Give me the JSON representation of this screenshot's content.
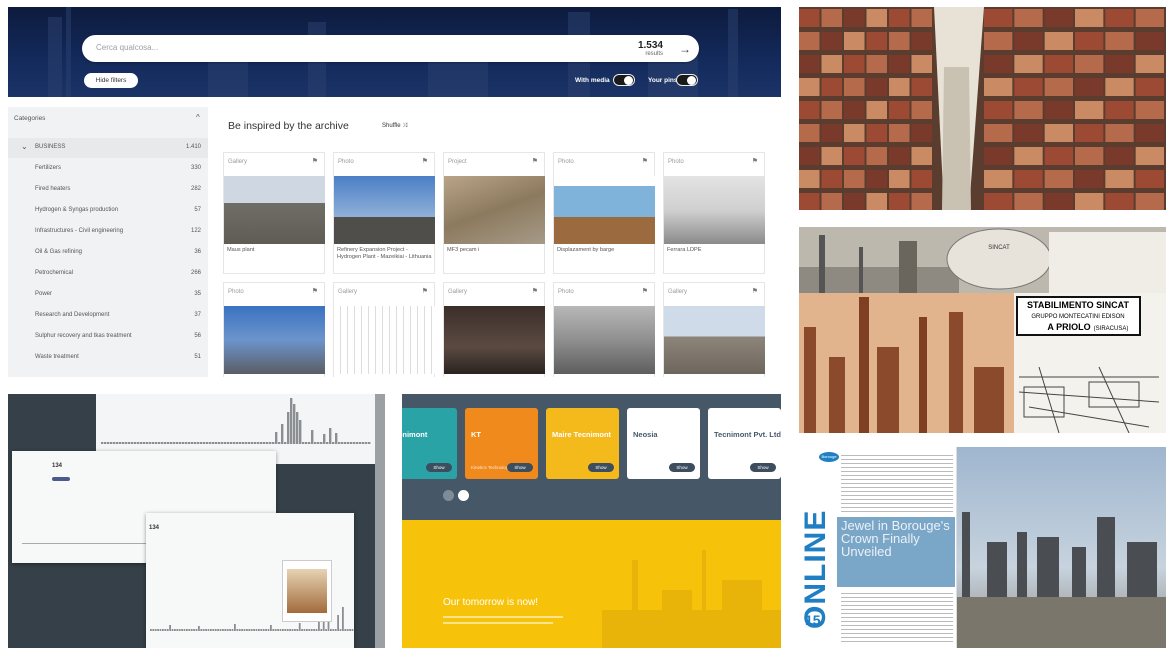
{
  "archive_ui": {
    "search": {
      "placeholder": "Cerca qualcosa...",
      "count": "1.534",
      "count_label": "results",
      "arrow": "→"
    },
    "hide_filters": "Hide filters",
    "toggles": [
      {
        "label": "With media"
      },
      {
        "label": "Your pins"
      }
    ],
    "categories": {
      "title": "Categories",
      "chevron": "^",
      "items": [
        {
          "expand": "⌄",
          "name": "BUSINESS",
          "count": "1.410"
        },
        {
          "expand": "",
          "name": "Fertilizers",
          "count": "330"
        },
        {
          "expand": "",
          "name": "Fired heaters",
          "count": "282"
        },
        {
          "expand": "",
          "name": "Hydrogen & Syngas production",
          "count": "57"
        },
        {
          "expand": "",
          "name": "Infrastructures - Civil engineering",
          "count": "122"
        },
        {
          "expand": "",
          "name": "Oil & Gas refining",
          "count": "36"
        },
        {
          "expand": "",
          "name": "Petrochemical",
          "count": "266"
        },
        {
          "expand": "",
          "name": "Power",
          "count": "35"
        },
        {
          "expand": "",
          "name": "Research and Development",
          "count": "37"
        },
        {
          "expand": "",
          "name": "Sulphur recovery and tkas treatment",
          "count": "56"
        },
        {
          "expand": "",
          "name": "Waste treatment",
          "count": "51"
        }
      ]
    },
    "main_title": "Be inspired by the archive",
    "shuffle": "Shuffle ⤨",
    "cards": [
      {
        "type": "Gallery",
        "caption": "Maus plant"
      },
      {
        "type": "Photo",
        "caption": "Refinery Expansion Project - Hydrogen Plant - Mazeikiai - Lithuania"
      },
      {
        "type": "Project",
        "caption": "MF3 pecam i"
      },
      {
        "type": "Photo",
        "caption": "Displazament by barge"
      },
      {
        "type": "Photo",
        "caption": "Ferrara LDPE"
      },
      {
        "type": "Photo",
        "caption": ""
      },
      {
        "type": "Gallery",
        "caption": ""
      },
      {
        "type": "Gallery",
        "caption": ""
      },
      {
        "type": "Photo",
        "caption": ""
      },
      {
        "type": "Gallery",
        "caption": ""
      }
    ]
  },
  "collage": {
    "sign_line1": "STABILIMENTO SINCAT",
    "sign_line2": "GRUPPO MONTECATINI EDISON",
    "sign_line3": "A PRIOLO",
    "sign_line3b": "(SIRACUSA)",
    "tank_text": "SINCAT"
  },
  "companies": {
    "items": [
      {
        "name": "Tecnimont",
        "sub": "",
        "btn": "Show"
      },
      {
        "name": "KT",
        "sub": "Kinetics Technology",
        "btn": "Show"
      },
      {
        "name": "Maire Tecnimont",
        "sub": "",
        "btn": "Show"
      },
      {
        "name": "Neosia",
        "sub": "",
        "btn": "Show"
      },
      {
        "name": "Tecnimont Pvt. Ltd",
        "sub": "",
        "btn": "Show"
      }
    ],
    "tagline": "Our tomorrow is now!"
  },
  "magazine": {
    "brand": "Borouge",
    "masthead": "ONLINE",
    "issue": "15",
    "headline": "Jewel in Borouge's Crown Finally Unveiled"
  },
  "timeline": {
    "card_value_1": "134",
    "card_value_2": "134"
  },
  "colors": {
    "accent_orange": "#f08a1c",
    "gold": "#f7c20a",
    "navy": "#13295a",
    "slate": "#465868",
    "magazine_blue": "#1f7fc2"
  }
}
